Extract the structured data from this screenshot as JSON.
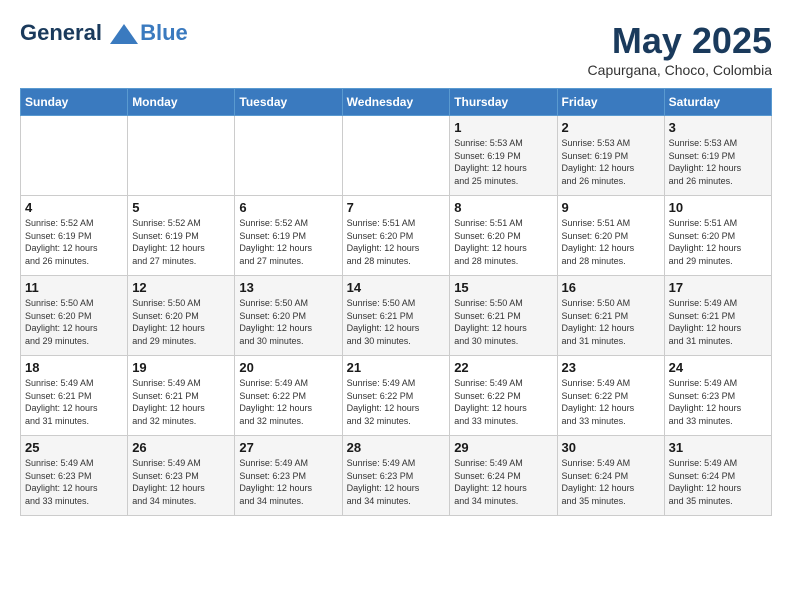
{
  "logo": {
    "line1": "General",
    "line2": "Blue"
  },
  "title": "May 2025",
  "location": "Capurgana, Choco, Colombia",
  "days_of_week": [
    "Sunday",
    "Monday",
    "Tuesday",
    "Wednesday",
    "Thursday",
    "Friday",
    "Saturday"
  ],
  "weeks": [
    [
      {
        "day": "",
        "info": ""
      },
      {
        "day": "",
        "info": ""
      },
      {
        "day": "",
        "info": ""
      },
      {
        "day": "",
        "info": ""
      },
      {
        "day": "1",
        "info": "Sunrise: 5:53 AM\nSunset: 6:19 PM\nDaylight: 12 hours\nand 25 minutes."
      },
      {
        "day": "2",
        "info": "Sunrise: 5:53 AM\nSunset: 6:19 PM\nDaylight: 12 hours\nand 26 minutes."
      },
      {
        "day": "3",
        "info": "Sunrise: 5:53 AM\nSunset: 6:19 PM\nDaylight: 12 hours\nand 26 minutes."
      }
    ],
    [
      {
        "day": "4",
        "info": "Sunrise: 5:52 AM\nSunset: 6:19 PM\nDaylight: 12 hours\nand 26 minutes."
      },
      {
        "day": "5",
        "info": "Sunrise: 5:52 AM\nSunset: 6:19 PM\nDaylight: 12 hours\nand 27 minutes."
      },
      {
        "day": "6",
        "info": "Sunrise: 5:52 AM\nSunset: 6:19 PM\nDaylight: 12 hours\nand 27 minutes."
      },
      {
        "day": "7",
        "info": "Sunrise: 5:51 AM\nSunset: 6:20 PM\nDaylight: 12 hours\nand 28 minutes."
      },
      {
        "day": "8",
        "info": "Sunrise: 5:51 AM\nSunset: 6:20 PM\nDaylight: 12 hours\nand 28 minutes."
      },
      {
        "day": "9",
        "info": "Sunrise: 5:51 AM\nSunset: 6:20 PM\nDaylight: 12 hours\nand 28 minutes."
      },
      {
        "day": "10",
        "info": "Sunrise: 5:51 AM\nSunset: 6:20 PM\nDaylight: 12 hours\nand 29 minutes."
      }
    ],
    [
      {
        "day": "11",
        "info": "Sunrise: 5:50 AM\nSunset: 6:20 PM\nDaylight: 12 hours\nand 29 minutes."
      },
      {
        "day": "12",
        "info": "Sunrise: 5:50 AM\nSunset: 6:20 PM\nDaylight: 12 hours\nand 29 minutes."
      },
      {
        "day": "13",
        "info": "Sunrise: 5:50 AM\nSunset: 6:20 PM\nDaylight: 12 hours\nand 30 minutes."
      },
      {
        "day": "14",
        "info": "Sunrise: 5:50 AM\nSunset: 6:21 PM\nDaylight: 12 hours\nand 30 minutes."
      },
      {
        "day": "15",
        "info": "Sunrise: 5:50 AM\nSunset: 6:21 PM\nDaylight: 12 hours\nand 30 minutes."
      },
      {
        "day": "16",
        "info": "Sunrise: 5:50 AM\nSunset: 6:21 PM\nDaylight: 12 hours\nand 31 minutes."
      },
      {
        "day": "17",
        "info": "Sunrise: 5:49 AM\nSunset: 6:21 PM\nDaylight: 12 hours\nand 31 minutes."
      }
    ],
    [
      {
        "day": "18",
        "info": "Sunrise: 5:49 AM\nSunset: 6:21 PM\nDaylight: 12 hours\nand 31 minutes."
      },
      {
        "day": "19",
        "info": "Sunrise: 5:49 AM\nSunset: 6:21 PM\nDaylight: 12 hours\nand 32 minutes."
      },
      {
        "day": "20",
        "info": "Sunrise: 5:49 AM\nSunset: 6:22 PM\nDaylight: 12 hours\nand 32 minutes."
      },
      {
        "day": "21",
        "info": "Sunrise: 5:49 AM\nSunset: 6:22 PM\nDaylight: 12 hours\nand 32 minutes."
      },
      {
        "day": "22",
        "info": "Sunrise: 5:49 AM\nSunset: 6:22 PM\nDaylight: 12 hours\nand 33 minutes."
      },
      {
        "day": "23",
        "info": "Sunrise: 5:49 AM\nSunset: 6:22 PM\nDaylight: 12 hours\nand 33 minutes."
      },
      {
        "day": "24",
        "info": "Sunrise: 5:49 AM\nSunset: 6:23 PM\nDaylight: 12 hours\nand 33 minutes."
      }
    ],
    [
      {
        "day": "25",
        "info": "Sunrise: 5:49 AM\nSunset: 6:23 PM\nDaylight: 12 hours\nand 33 minutes."
      },
      {
        "day": "26",
        "info": "Sunrise: 5:49 AM\nSunset: 6:23 PM\nDaylight: 12 hours\nand 34 minutes."
      },
      {
        "day": "27",
        "info": "Sunrise: 5:49 AM\nSunset: 6:23 PM\nDaylight: 12 hours\nand 34 minutes."
      },
      {
        "day": "28",
        "info": "Sunrise: 5:49 AM\nSunset: 6:23 PM\nDaylight: 12 hours\nand 34 minutes."
      },
      {
        "day": "29",
        "info": "Sunrise: 5:49 AM\nSunset: 6:24 PM\nDaylight: 12 hours\nand 34 minutes."
      },
      {
        "day": "30",
        "info": "Sunrise: 5:49 AM\nSunset: 6:24 PM\nDaylight: 12 hours\nand 35 minutes."
      },
      {
        "day": "31",
        "info": "Sunrise: 5:49 AM\nSunset: 6:24 PM\nDaylight: 12 hours\nand 35 minutes."
      }
    ]
  ]
}
